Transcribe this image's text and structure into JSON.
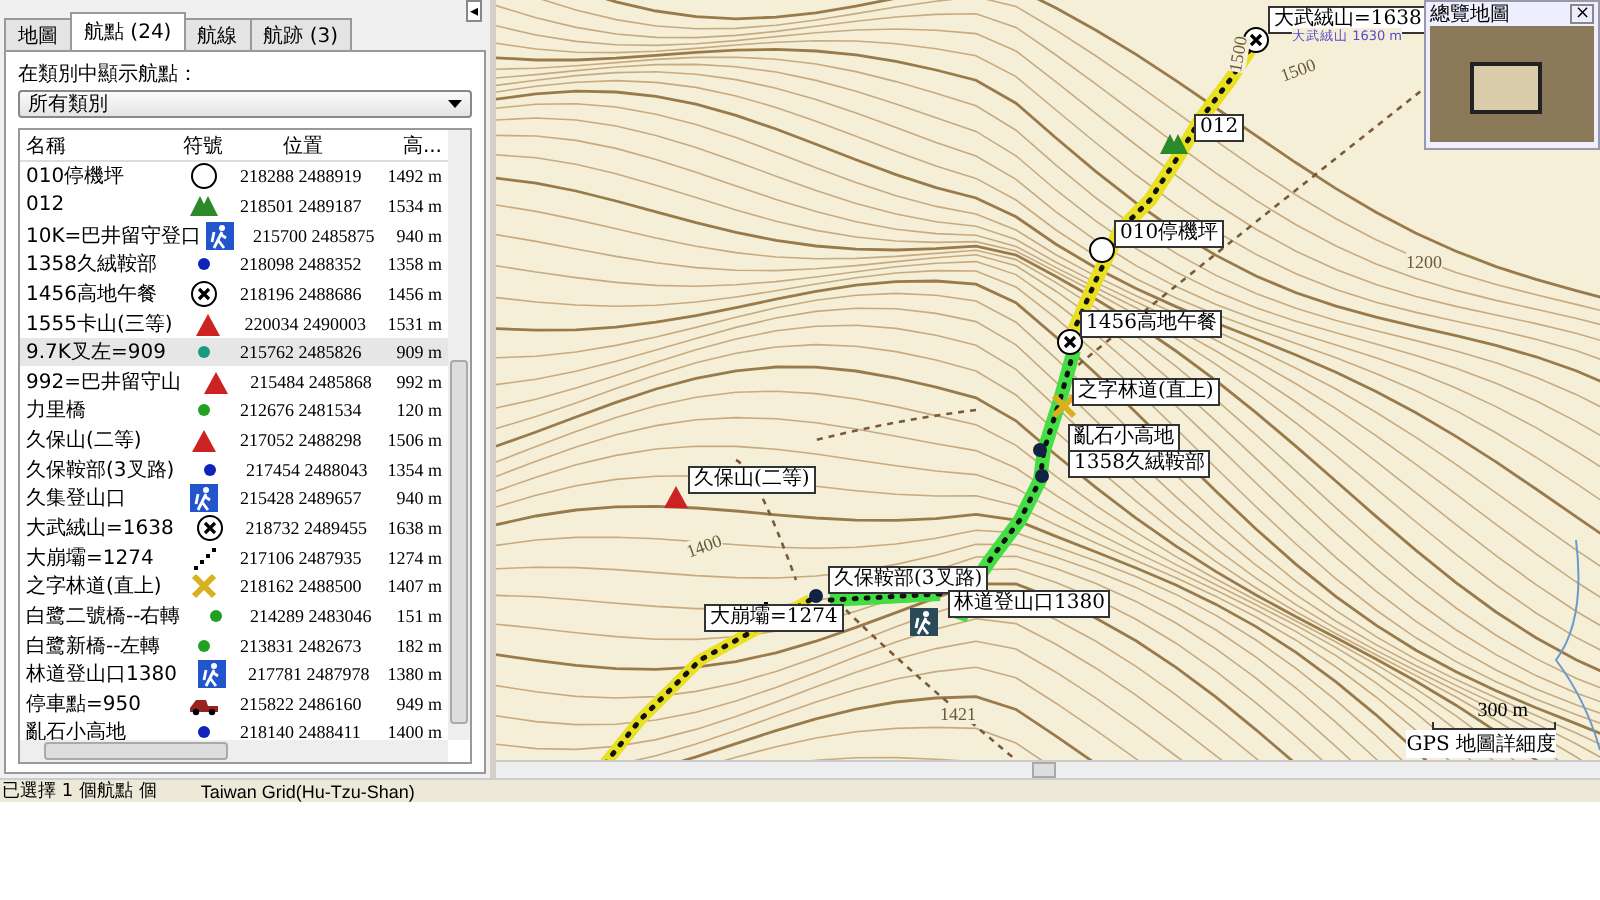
{
  "collapse_button": "◂",
  "tabs": [
    {
      "label": "地圖",
      "selected": false
    },
    {
      "label": "航點 (24)",
      "selected": true
    },
    {
      "label": "航線",
      "selected": false
    },
    {
      "label": "航跡 (3)",
      "selected": false
    }
  ],
  "category": {
    "label": "在類別中顯示航點：",
    "value": "所有類別"
  },
  "table": {
    "columns": [
      "名稱",
      "符號",
      "位置",
      "高..."
    ],
    "rows": [
      {
        "name": "010停機坪",
        "kind": "circle",
        "position": "218288 2488919",
        "altitude": "1492 m",
        "selected": false
      },
      {
        "name": "012",
        "kind": "tent",
        "position": "218501 2489187",
        "altitude": "1534 m",
        "selected": false
      },
      {
        "name": "10K=巴井留守登口",
        "kind": "hiker",
        "position": "215700 2485875",
        "altitude": "940 m",
        "selected": false
      },
      {
        "name": "1358久絨鞍部",
        "kind": "dot",
        "color": "#1122bb",
        "position": "218098 2488352",
        "altitude": "1358 m",
        "selected": false
      },
      {
        "name": "1456高地午餐",
        "kind": "x-circle",
        "position": "218196 2488686",
        "altitude": "1456 m",
        "selected": false
      },
      {
        "name": "1555卡山(三等)",
        "kind": "triangle",
        "position": "220034 2490003",
        "altitude": "1531 m",
        "selected": false
      },
      {
        "name": "9.7K叉左=909",
        "kind": "dot",
        "color": "#1a9a80",
        "position": "215762 2485826",
        "altitude": "909 m",
        "selected": true
      },
      {
        "name": "992=巴井留守山",
        "kind": "triangle",
        "position": "215484 2485868",
        "altitude": "992 m",
        "selected": false
      },
      {
        "name": "力里橋",
        "kind": "dot",
        "color": "#22a022",
        "position": "212676 2481534",
        "altitude": "120 m",
        "selected": false
      },
      {
        "name": "久保山(二等)",
        "kind": "triangle",
        "position": "217052 2488298",
        "altitude": "1506 m",
        "selected": false
      },
      {
        "name": "久保鞍部(3叉路)",
        "kind": "dot",
        "color": "#1122bb",
        "position": "217454 2488043",
        "altitude": "1354 m",
        "selected": false
      },
      {
        "name": "久集登山口",
        "kind": "hiker",
        "position": "215428 2489657",
        "altitude": "940 m",
        "selected": false
      },
      {
        "name": "大武絨山=1638",
        "kind": "x-circle",
        "position": "218732 2489455",
        "altitude": "1638 m",
        "selected": false
      },
      {
        "name": "大崩壩=1274",
        "kind": "footprints",
        "position": "217106 2487935",
        "altitude": "1274 m",
        "selected": false
      },
      {
        "name": "之字林道(直上)",
        "kind": "cross",
        "position": "218162 2488500",
        "altitude": "1407 m",
        "selected": false
      },
      {
        "name": "白鹭二號橋--右轉",
        "kind": "dot",
        "color": "#22a022",
        "position": "214289 2483046",
        "altitude": "151 m",
        "selected": false
      },
      {
        "name": "白鹭新橋--左轉",
        "kind": "dot",
        "color": "#22a022",
        "position": "213831 2482673",
        "altitude": "182 m",
        "selected": false
      },
      {
        "name": "林道登山口1380",
        "kind": "hiker",
        "position": "217781 2487978",
        "altitude": "1380 m",
        "selected": false
      },
      {
        "name": "停車點=950",
        "kind": "car",
        "position": "215822 2486160",
        "altitude": "949 m",
        "selected": false
      },
      {
        "name": "亂石小高地",
        "kind": "dot",
        "color": "#1122bb",
        "position": "218140 2488411",
        "altitude": "1400 m",
        "selected": false
      }
    ]
  },
  "status_bar": [
    "已選擇 1 個航點 個",
    "Taiwan Grid(Hu-Tzu-Shan)"
  ],
  "map": {
    "waypoints": [
      {
        "label": "大武絨山=1638",
        "kind": "x-circle"
      },
      {
        "label": "012",
        "kind": "tent"
      },
      {
        "label": "010停機坪",
        "kind": "circle"
      },
      {
        "label": "1456高地午餐",
        "kind": "x-circle"
      },
      {
        "label": "之字林道(直上)",
        "kind": "cross"
      },
      {
        "label": "亂石小高地",
        "kind": "dot"
      },
      {
        "label": "1358久絨鞍部",
        "kind": "dot"
      },
      {
        "label": "久保山(二等)",
        "kind": "triangle"
      },
      {
        "label": "久保鞍部(3叉路)",
        "kind": "dot"
      },
      {
        "label": "林道登山口1380",
        "kind": "hiker"
      },
      {
        "label": "大崩壩=1274",
        "kind": "footprints"
      }
    ],
    "contour_labels": [
      "1500",
      "1500",
      "1200",
      "1400",
      "1421"
    ],
    "peak_label": "大武絨山 1630 m",
    "scale": "300 m",
    "detail_label": "GPS 地圖詳細度",
    "overview": {
      "title": "總覽地圖",
      "close": "×"
    }
  }
}
